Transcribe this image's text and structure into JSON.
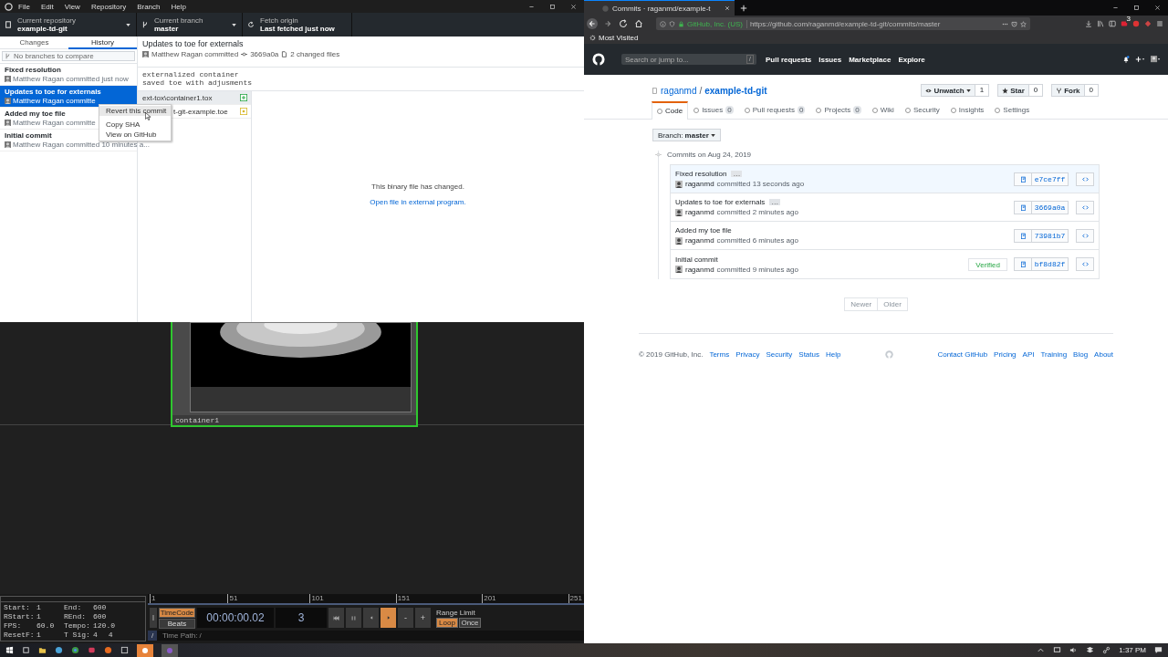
{
  "desktop_app": {
    "menu": [
      "File",
      "Edit",
      "View",
      "Repository",
      "Branch",
      "Help"
    ],
    "toolbar": [
      {
        "kind": "repo",
        "label": "Current repository",
        "value": "example-td-git"
      },
      {
        "kind": "branch",
        "label": "Current branch",
        "value": "master"
      },
      {
        "kind": "fetch",
        "label": "Fetch origin",
        "value": "Last fetched just now"
      }
    ],
    "tabs": [
      {
        "label": "Changes",
        "selected": false
      },
      {
        "label": "History",
        "selected": true
      }
    ],
    "compare_placeholder": "No branches to compare",
    "commits": [
      {
        "title": "Fixed resolution",
        "meta": "Matthew Ragan committed just now",
        "selected": false
      },
      {
        "title": "Updates to toe for externals",
        "meta": "Matthew Ragan committe",
        "selected": true
      },
      {
        "title": "Added my toe file",
        "meta": "Matthew Ragan committe",
        "selected": false
      },
      {
        "title": "Initial commit",
        "meta": "Matthew Ragan committed 10 minutes a...",
        "selected": false
      }
    ],
    "context_menu": [
      {
        "label": "Revert this commit",
        "selected": true
      },
      {
        "label": "Copy SHA",
        "selected": false
      },
      {
        "label": "View on GitHub",
        "selected": false
      }
    ],
    "detail": {
      "title": "Updates to toe for externals",
      "author": "Matthew Ragan committed",
      "sha": "3669a0a",
      "files_count": "2 changed files",
      "message": [
        "externalized container",
        "saved toe with adjusments"
      ],
      "files": [
        {
          "name": "ext-tox\\container1.tox",
          "kind": "added",
          "selected": true
        },
        {
          "name": "t-git-example.toe",
          "kind": "modified",
          "selected": false
        }
      ],
      "binary_note": "This binary file has changed.",
      "open_link": "Open file in external program."
    }
  },
  "touchdesigner": {
    "node_label": "container1",
    "info": [
      {
        "label": "Start:",
        "values": [
          "1"
        ]
      },
      {
        "label": "End:",
        "values": [
          "600"
        ]
      },
      {
        "label": "RStart:",
        "values": [
          "1"
        ]
      },
      {
        "label": "REnd:",
        "values": [
          "600"
        ]
      },
      {
        "label": "FPS:",
        "values": [
          "60.0"
        ]
      },
      {
        "label": "Tempo:",
        "values": [
          "120.0"
        ]
      },
      {
        "label": "ResetF:",
        "values": [
          "1"
        ]
      },
      {
        "label": "T Sig:",
        "values": [
          "4",
          "4"
        ]
      }
    ],
    "ruler": [
      "1",
      "51",
      "101",
      "151",
      "201",
      "251"
    ],
    "time_modes": [
      {
        "label": "TimeCode",
        "selected": true
      },
      {
        "label": "Beats",
        "selected": false
      }
    ],
    "timecode": "00:00:00.02",
    "frame": "3",
    "transport": [
      {
        "kind": "start",
        "selected": false
      },
      {
        "kind": "pause",
        "selected": false
      },
      {
        "kind": "back",
        "selected": false
      },
      {
        "kind": "play",
        "selected": true
      },
      {
        "kind": "minus",
        "label": "-",
        "selected": false
      },
      {
        "kind": "plus",
        "label": "+",
        "selected": false
      }
    ],
    "range_limit": "Range Limit",
    "range_modes": [
      {
        "label": "Loop",
        "selected": true
      },
      {
        "label": "Once",
        "selected": false
      }
    ],
    "path_button": "/",
    "time_path": "Time Path: /"
  },
  "browser": {
    "tab_title": "Commits · raganmd/example-t",
    "identity": "GitHub, Inc. (US)",
    "url": "https://github.com/raganmd/example-td-git/commits/master",
    "bookmark": "Most Visited",
    "badge": "3"
  },
  "github": {
    "search_placeholder": "Search or jump to...",
    "search_key": "/",
    "nav": [
      "Pull requests",
      "Issues",
      "Marketplace",
      "Explore"
    ],
    "owner": "raganmd",
    "separator": "/",
    "repo": "example-td-git",
    "actions": [
      {
        "kind": "watch",
        "label": "Unwatch",
        "count": "1"
      },
      {
        "kind": "star",
        "label": "Star",
        "count": "0"
      },
      {
        "kind": "fork",
        "label": "Fork",
        "count": "0"
      }
    ],
    "tabs": [
      {
        "label": "Code",
        "selected": true
      },
      {
        "label": "Issues",
        "count": "0",
        "selected": false
      },
      {
        "label": "Pull requests",
        "count": "0",
        "selected": false
      },
      {
        "label": "Projects",
        "count": "0",
        "selected": false
      },
      {
        "label": "Wiki",
        "selected": false
      },
      {
        "label": "Security",
        "selected": false
      },
      {
        "label": "Insights",
        "selected": false
      },
      {
        "label": "Settings",
        "selected": false
      }
    ],
    "branch_label": "Branch:",
    "branch": "master",
    "date_heading": "Commits on Aug 24, 2019",
    "commits": [
      {
        "title": "Fixed resolution",
        "expander": "…",
        "author": "raganmd",
        "time": "committed 13 seconds ago",
        "sha": "e7ce7ff",
        "highlighted": true
      },
      {
        "title": "Updates to toe for externals",
        "expander": "…",
        "author": "raganmd",
        "time": "committed 2 minutes ago",
        "sha": "3669a0a",
        "highlighted": false
      },
      {
        "title": "Added my toe file",
        "author": "raganmd",
        "time": "committed 6 minutes ago",
        "sha": "73981b7",
        "highlighted": false
      },
      {
        "title": "Initial commit",
        "author": "raganmd",
        "time": "committed 9 minutes ago",
        "sha": "bf8d82f",
        "badge": "Verified",
        "highlighted": false
      }
    ],
    "pager": [
      "Newer",
      "Older"
    ],
    "footer_left": [
      "© 2019 GitHub, Inc.",
      "Terms",
      "Privacy",
      "Security",
      "Status",
      "Help"
    ],
    "footer_right": [
      "Contact GitHub",
      "Pricing",
      "API",
      "Training",
      "Blog",
      "About"
    ]
  },
  "taskbar": {
    "time": "1:37 PM"
  }
}
